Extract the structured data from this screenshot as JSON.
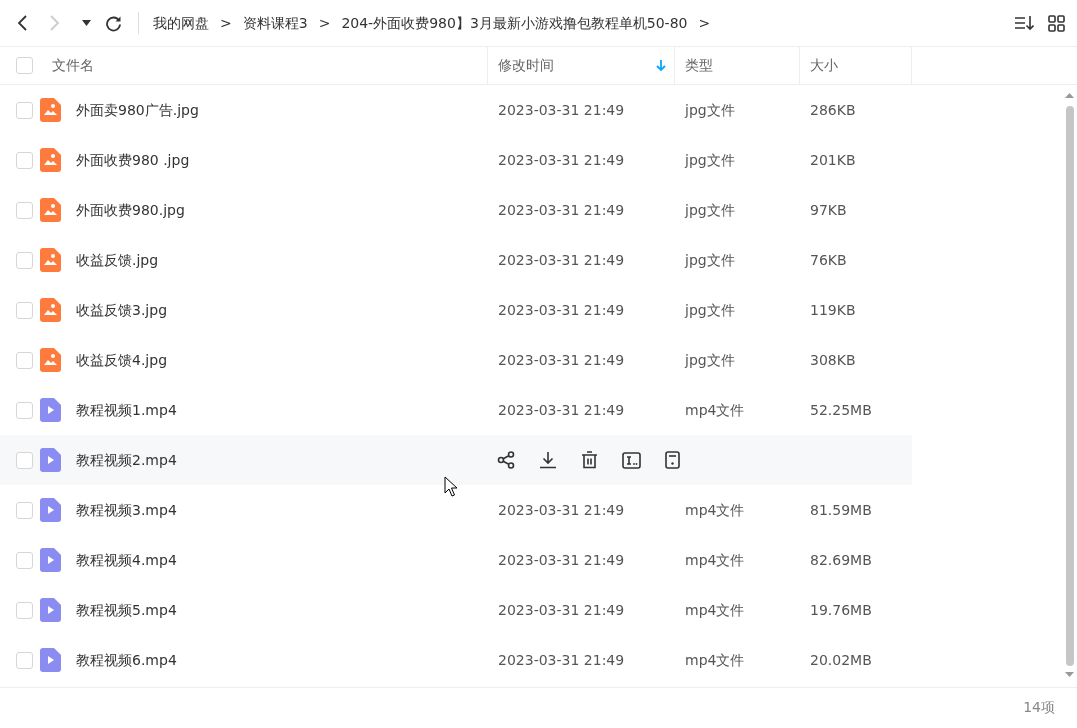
{
  "toolbar": {
    "back_disabled": false,
    "forward_disabled": true,
    "breadcrumbs": [
      "我的网盘",
      "资料课程3",
      "204-外面收费980】3月最新小游戏撸包教程单机50-80"
    ],
    "separator": ">"
  },
  "columns": [
    {
      "label": "文件名",
      "sorted": false
    },
    {
      "label": "修改时间",
      "sorted": true
    },
    {
      "label": "类型",
      "sorted": false
    },
    {
      "label": "大小",
      "sorted": false
    }
  ],
  "select_all": {
    "checked": false
  },
  "rows": [
    {
      "kind": "image",
      "name": "外面卖980广告.jpg",
      "modified": "2023-03-31 21:49",
      "type": "jpg文件",
      "size": "286KB",
      "checked": false,
      "hovered": false
    },
    {
      "kind": "image",
      "name": "外面收费980 .jpg",
      "modified": "2023-03-31 21:49",
      "type": "jpg文件",
      "size": "201KB",
      "checked": false,
      "hovered": false
    },
    {
      "kind": "image",
      "name": "外面收费980.jpg",
      "modified": "2023-03-31 21:49",
      "type": "jpg文件",
      "size": "97KB",
      "checked": false,
      "hovered": false
    },
    {
      "kind": "image",
      "name": "收益反馈.jpg",
      "modified": "2023-03-31 21:49",
      "type": "jpg文件",
      "size": "76KB",
      "checked": false,
      "hovered": false
    },
    {
      "kind": "image",
      "name": "收益反馈3.jpg",
      "modified": "2023-03-31 21:49",
      "type": "jpg文件",
      "size": "119KB",
      "checked": false,
      "hovered": false
    },
    {
      "kind": "image",
      "name": "收益反馈4.jpg",
      "modified": "2023-03-31 21:49",
      "type": "jpg文件",
      "size": "308KB",
      "checked": false,
      "hovered": false
    },
    {
      "kind": "video",
      "name": "教程视频1.mp4",
      "modified": "2023-03-31 21:49",
      "type": "mp4文件",
      "size": "52.25MB",
      "checked": false,
      "hovered": false
    },
    {
      "kind": "video",
      "name": "教程视频2.mp4",
      "checked": false,
      "hovered": true
    },
    {
      "kind": "video",
      "name": "教程视频3.mp4",
      "modified": "2023-03-31 21:49",
      "type": "mp4文件",
      "size": "81.59MB",
      "checked": false,
      "hovered": false
    },
    {
      "kind": "video",
      "name": "教程视频4.mp4",
      "modified": "2023-03-31 21:49",
      "type": "mp4文件",
      "size": "82.69MB",
      "checked": false,
      "hovered": false
    },
    {
      "kind": "video",
      "name": "教程视频5.mp4",
      "modified": "2023-03-31 21:49",
      "type": "mp4文件",
      "size": "19.76MB",
      "checked": false,
      "hovered": false
    },
    {
      "kind": "video",
      "name": "教程视频6.mp4",
      "modified": "2023-03-31 21:49",
      "type": "mp4文件",
      "size": "20.02MB",
      "checked": false,
      "hovered": false
    }
  ],
  "status_bar": {
    "count": "14项"
  }
}
